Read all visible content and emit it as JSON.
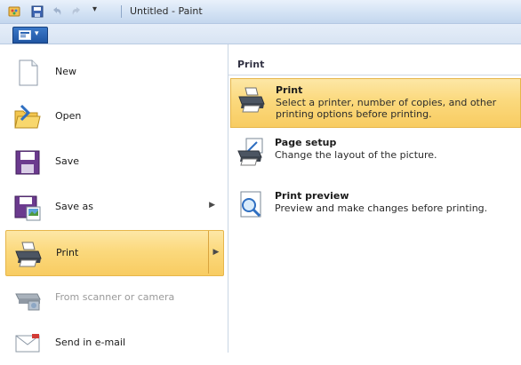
{
  "titlebar": {
    "title": "Untitled - Paint"
  },
  "menu": {
    "items": [
      {
        "label": "New",
        "state": "normal",
        "icon": "new-document-icon"
      },
      {
        "label": "Open",
        "state": "normal",
        "icon": "open-folder-icon"
      },
      {
        "label": "Save",
        "state": "normal",
        "icon": "save-floppy-icon"
      },
      {
        "label": "Save as",
        "state": "normal",
        "icon": "save-as-icon",
        "has_submenu": true
      },
      {
        "label": "Print",
        "state": "active",
        "icon": "printer-icon",
        "has_submenu": true
      },
      {
        "label": "From scanner or camera",
        "state": "disabled",
        "icon": "scanner-icon"
      },
      {
        "label": "Send in e-mail",
        "state": "normal",
        "icon": "email-icon"
      }
    ]
  },
  "submenu": {
    "header": "Print",
    "items": [
      {
        "title": "Print",
        "desc": "Select a printer, number of copies, and other printing options before printing.",
        "icon": "printer-icon",
        "state": "active"
      },
      {
        "title": "Page setup",
        "desc": "Change the layout of the picture.",
        "icon": "page-setup-icon",
        "state": "normal"
      },
      {
        "title": "Print preview",
        "desc": "Preview and make changes before printing.",
        "icon": "print-preview-icon",
        "state": "normal"
      }
    ]
  },
  "colors": {
    "highlight": "#fbd97d",
    "highlight_border": "#e6b64b",
    "file_tab": "#2a63b3"
  }
}
